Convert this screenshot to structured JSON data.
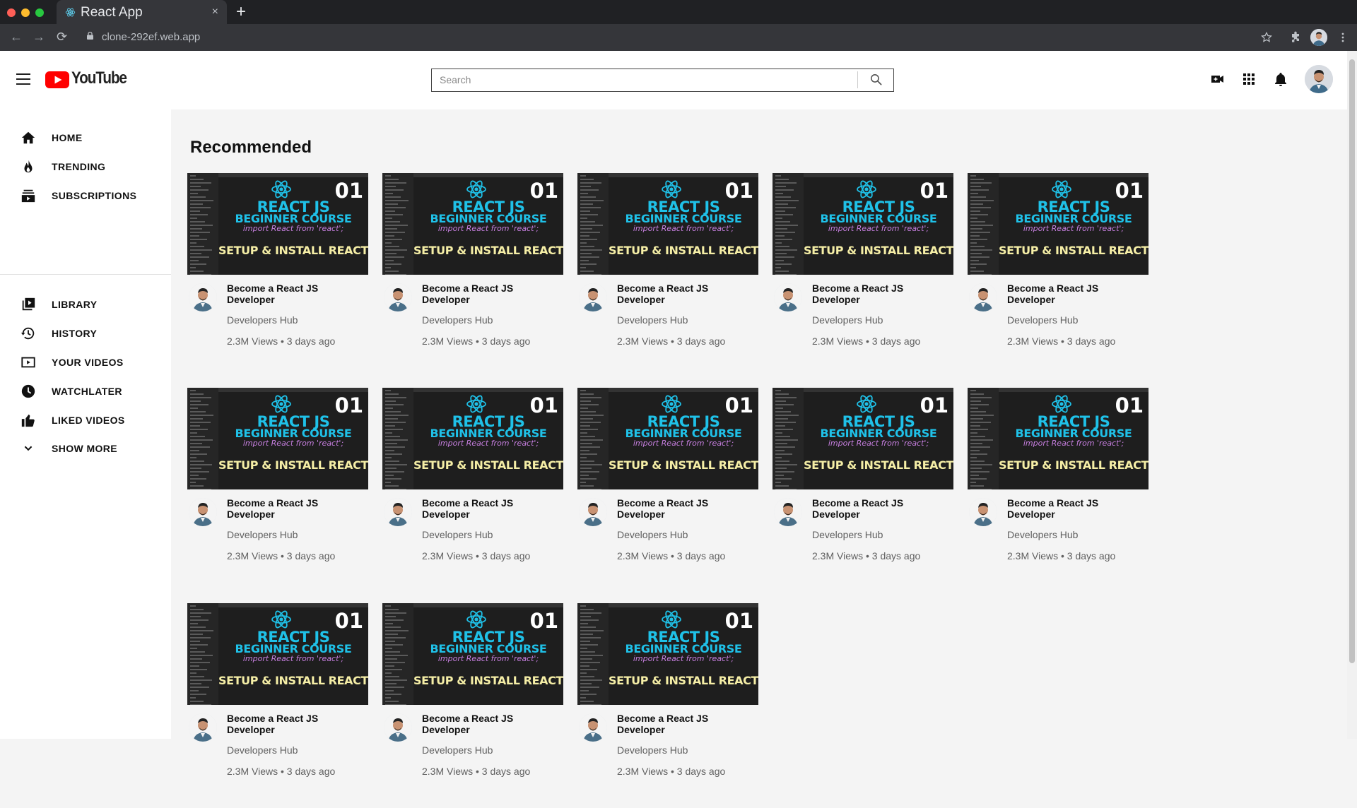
{
  "browser": {
    "tab_title": "React App",
    "tab_close": "×",
    "new_tab": "+",
    "url": "clone-292ef.web.app",
    "back": "←",
    "forward": "→",
    "reload": "⟳"
  },
  "header": {
    "logo_text": "YouTube",
    "search_placeholder": "Search",
    "search_value": ""
  },
  "sidebar": {
    "primary": [
      {
        "label": "HOME",
        "icon": "home-icon"
      },
      {
        "label": "TRENDING",
        "icon": "trending-icon"
      },
      {
        "label": "SUBSCRIPTIONS",
        "icon": "subscriptions-icon"
      }
    ],
    "secondary": [
      {
        "label": "LIBRARY",
        "icon": "library-icon"
      },
      {
        "label": "HISTORY",
        "icon": "history-icon"
      },
      {
        "label": "YOUR VIDEOS",
        "icon": "your-videos-icon"
      },
      {
        "label": "WATCHLATER",
        "icon": "watch-later-icon"
      },
      {
        "label": "LIKED VIDEOS",
        "icon": "liked-videos-icon"
      },
      {
        "label": "SHOW MORE",
        "icon": "chevron-down-icon"
      }
    ]
  },
  "main": {
    "title": "Recommended",
    "videos": [
      {
        "title": "Become a React JS Developer",
        "channel": "Developers Hub",
        "meta": "2.3M Views • 3 days ago"
      },
      {
        "title": "Become a React JS Developer",
        "channel": "Developers Hub",
        "meta": "2.3M Views • 3 days ago"
      },
      {
        "title": "Become a React JS Developer",
        "channel": "Developers Hub",
        "meta": "2.3M Views • 3 days ago"
      },
      {
        "title": "Become a React JS Developer",
        "channel": "Developers Hub",
        "meta": "2.3M Views • 3 days ago"
      },
      {
        "title": "Become a React JS Developer",
        "channel": "Developers Hub",
        "meta": "2.3M Views • 3 days ago"
      },
      {
        "title": "Become a React JS Developer",
        "channel": "Developers Hub",
        "meta": "2.3M Views • 3 days ago"
      },
      {
        "title": "Become a React JS Developer",
        "channel": "Developers Hub",
        "meta": "2.3M Views • 3 days ago"
      },
      {
        "title": "Become a React JS Developer",
        "channel": "Developers Hub",
        "meta": "2.3M Views • 3 days ago"
      },
      {
        "title": "Become a React JS Developer",
        "channel": "Developers Hub",
        "meta": "2.3M Views • 3 days ago"
      },
      {
        "title": "Become a React JS Developer",
        "channel": "Developers Hub",
        "meta": "2.3M Views • 3 days ago"
      },
      {
        "title": "Become a React JS Developer",
        "channel": "Developers Hub",
        "meta": "2.3M Views • 3 days ago"
      },
      {
        "title": "Become a React JS Developer",
        "channel": "Developers Hub",
        "meta": "2.3M Views • 3 days ago"
      },
      {
        "title": "Become a React JS Developer",
        "channel": "Developers Hub",
        "meta": "2.3M Views • 3 days ago"
      }
    ],
    "thumbnail": {
      "number": "01",
      "line1": "REACT JS",
      "line2": "BEGINNER COURSE",
      "line3": "import React from 'react';",
      "line4": "SETUP & INSTALL REACT"
    }
  },
  "colors": {
    "youtube_red": "#ff0000",
    "thumb_cyan": "#1fc1e8",
    "thumb_yellow": "#f5eea6",
    "thumb_purple": "#c77fe0"
  }
}
